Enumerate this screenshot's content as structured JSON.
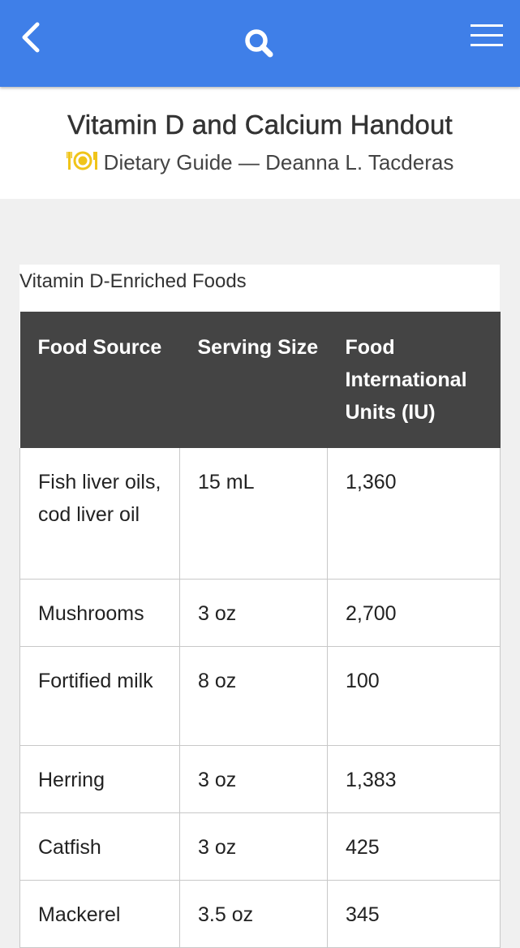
{
  "appbar": {
    "back_icon": "chevron-left-icon",
    "search_icon": "search-icon",
    "menu_icon": "hamburger-menu-icon",
    "color": "#3f7fe8"
  },
  "header": {
    "title": "Vitamin D and Calcium Handout",
    "subtitle": "Dietary Guide — Deanna L. Tacderas",
    "subtitle_icon": "plate-utensils-icon",
    "icon_color": "#f0c419"
  },
  "table": {
    "caption": "Vitamin D-Enriched Foods",
    "columns": [
      "Food Source",
      "Serving Size",
      "Food International Units (IU)"
    ],
    "rows": [
      [
        "Fish liver oils, cod liver oil",
        "15 mL",
        "1,360"
      ],
      [
        "Mushrooms",
        "3 oz",
        "2,700"
      ],
      [
        "Fortified milk",
        "8 oz",
        "100"
      ],
      [
        "Herring",
        "3 oz",
        "1,383"
      ],
      [
        "Catfish",
        "3 oz",
        "425"
      ],
      [
        "Mackerel",
        "3.5 oz",
        "345"
      ]
    ]
  }
}
